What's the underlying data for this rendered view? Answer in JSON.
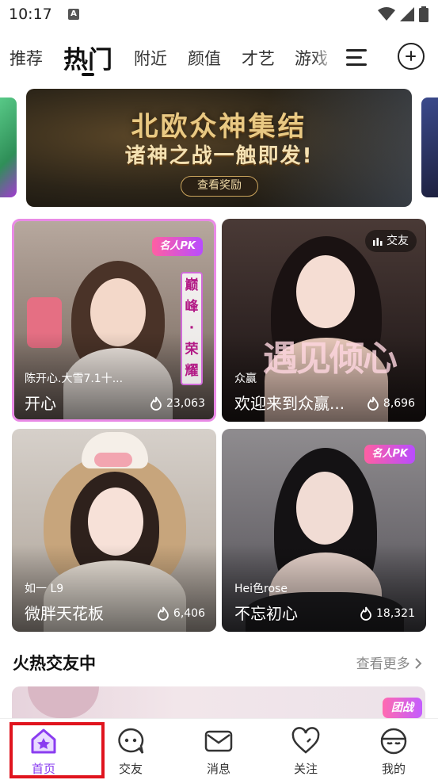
{
  "status_bar": {
    "time": "10:17",
    "notif_icon": "A"
  },
  "tabs": [
    {
      "label": "推荐",
      "active": false
    },
    {
      "label": "热门",
      "active": true
    },
    {
      "label": "附近",
      "active": false
    },
    {
      "label": "颜值",
      "active": false
    },
    {
      "label": "才艺",
      "active": false
    },
    {
      "label": "游戏",
      "active": false
    }
  ],
  "banner": {
    "title": "北欧众神集结",
    "subtitle": "诸神之战一触即发!",
    "button": "查看奖励"
  },
  "cards": [
    {
      "host": "陈开心.大雪7.1十...",
      "title": "开心",
      "heat": "23,063",
      "badge": "名人PK",
      "vertical_text": [
        "巅",
        "峰",
        "·",
        "荣",
        "耀"
      ]
    },
    {
      "host": "众赢",
      "title": "欢迎来到众赢...",
      "heat": "8,696",
      "badge": "交友",
      "overlay_text": "遇见倾心"
    },
    {
      "host": "如一 L9",
      "title": "微胖天花板",
      "heat": "6,406"
    },
    {
      "host": "Hei色rose",
      "title": "不忘初心",
      "heat": "18,321",
      "badge": "名人PK"
    }
  ],
  "section": {
    "title": "火热交友中",
    "more": "查看更多"
  },
  "peek_badge": "团战",
  "bottom_nav": [
    {
      "label": "首页",
      "icon": "home-icon",
      "active": true
    },
    {
      "label": "交友",
      "icon": "chat-bubble-icon",
      "active": false
    },
    {
      "label": "消息",
      "icon": "envelope-icon",
      "active": false
    },
    {
      "label": "关注",
      "icon": "heart-icon",
      "active": false
    },
    {
      "label": "我的",
      "icon": "profile-icon",
      "active": false
    }
  ],
  "colors": {
    "accent": "#8a3cf0",
    "highlight": "#e0141e",
    "badge_pink": "#ff5fa2"
  }
}
